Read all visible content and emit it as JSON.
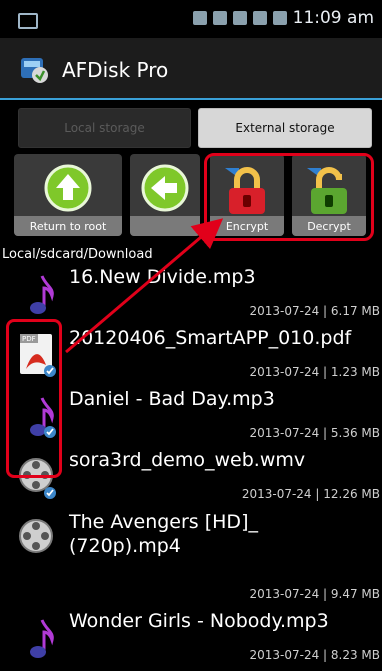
{
  "status_bar": {
    "time": "11:09 am"
  },
  "action_bar": {
    "title": "AFDisk Pro"
  },
  "tabs": [
    {
      "label": "Local storage"
    },
    {
      "label": "External storage"
    }
  ],
  "toolbar": {
    "root_label": "Return to root",
    "encrypt_label": "Encrypt",
    "decrypt_label": "Decrypt"
  },
  "path": "Local/sdcard/Download",
  "files": [
    {
      "name": "16.New Divide.mp3",
      "meta": "2013-07-24 | 6.17 MB",
      "icon": "music-note-icon"
    },
    {
      "name": "20120406_SmartAPP_010.pdf",
      "meta": "2013-07-24 | 1.23 MB",
      "icon": "pdf-icon"
    },
    {
      "name": "Daniel - Bad Day.mp3",
      "meta": "2013-07-24 | 5.36 MB",
      "icon": "music-note-icon"
    },
    {
      "name": "sora3rd_demo_web.wmv",
      "meta": "2013-07-24 | 12.26 MB",
      "icon": "video-reel-icon"
    },
    {
      "name": "The Avengers [HD]_",
      "name2": "(720p).mp4",
      "meta": "2013-07-24 | 9.47 MB",
      "icon": "video-reel-icon"
    },
    {
      "name": "Wonder Girls - Nobody.mp3",
      "meta": "2013-07-24 | 8.23 MB",
      "icon": "music-note-icon"
    }
  ],
  "colors": {
    "accent": "#3aa0d7",
    "highlight": "#e1001a"
  }
}
